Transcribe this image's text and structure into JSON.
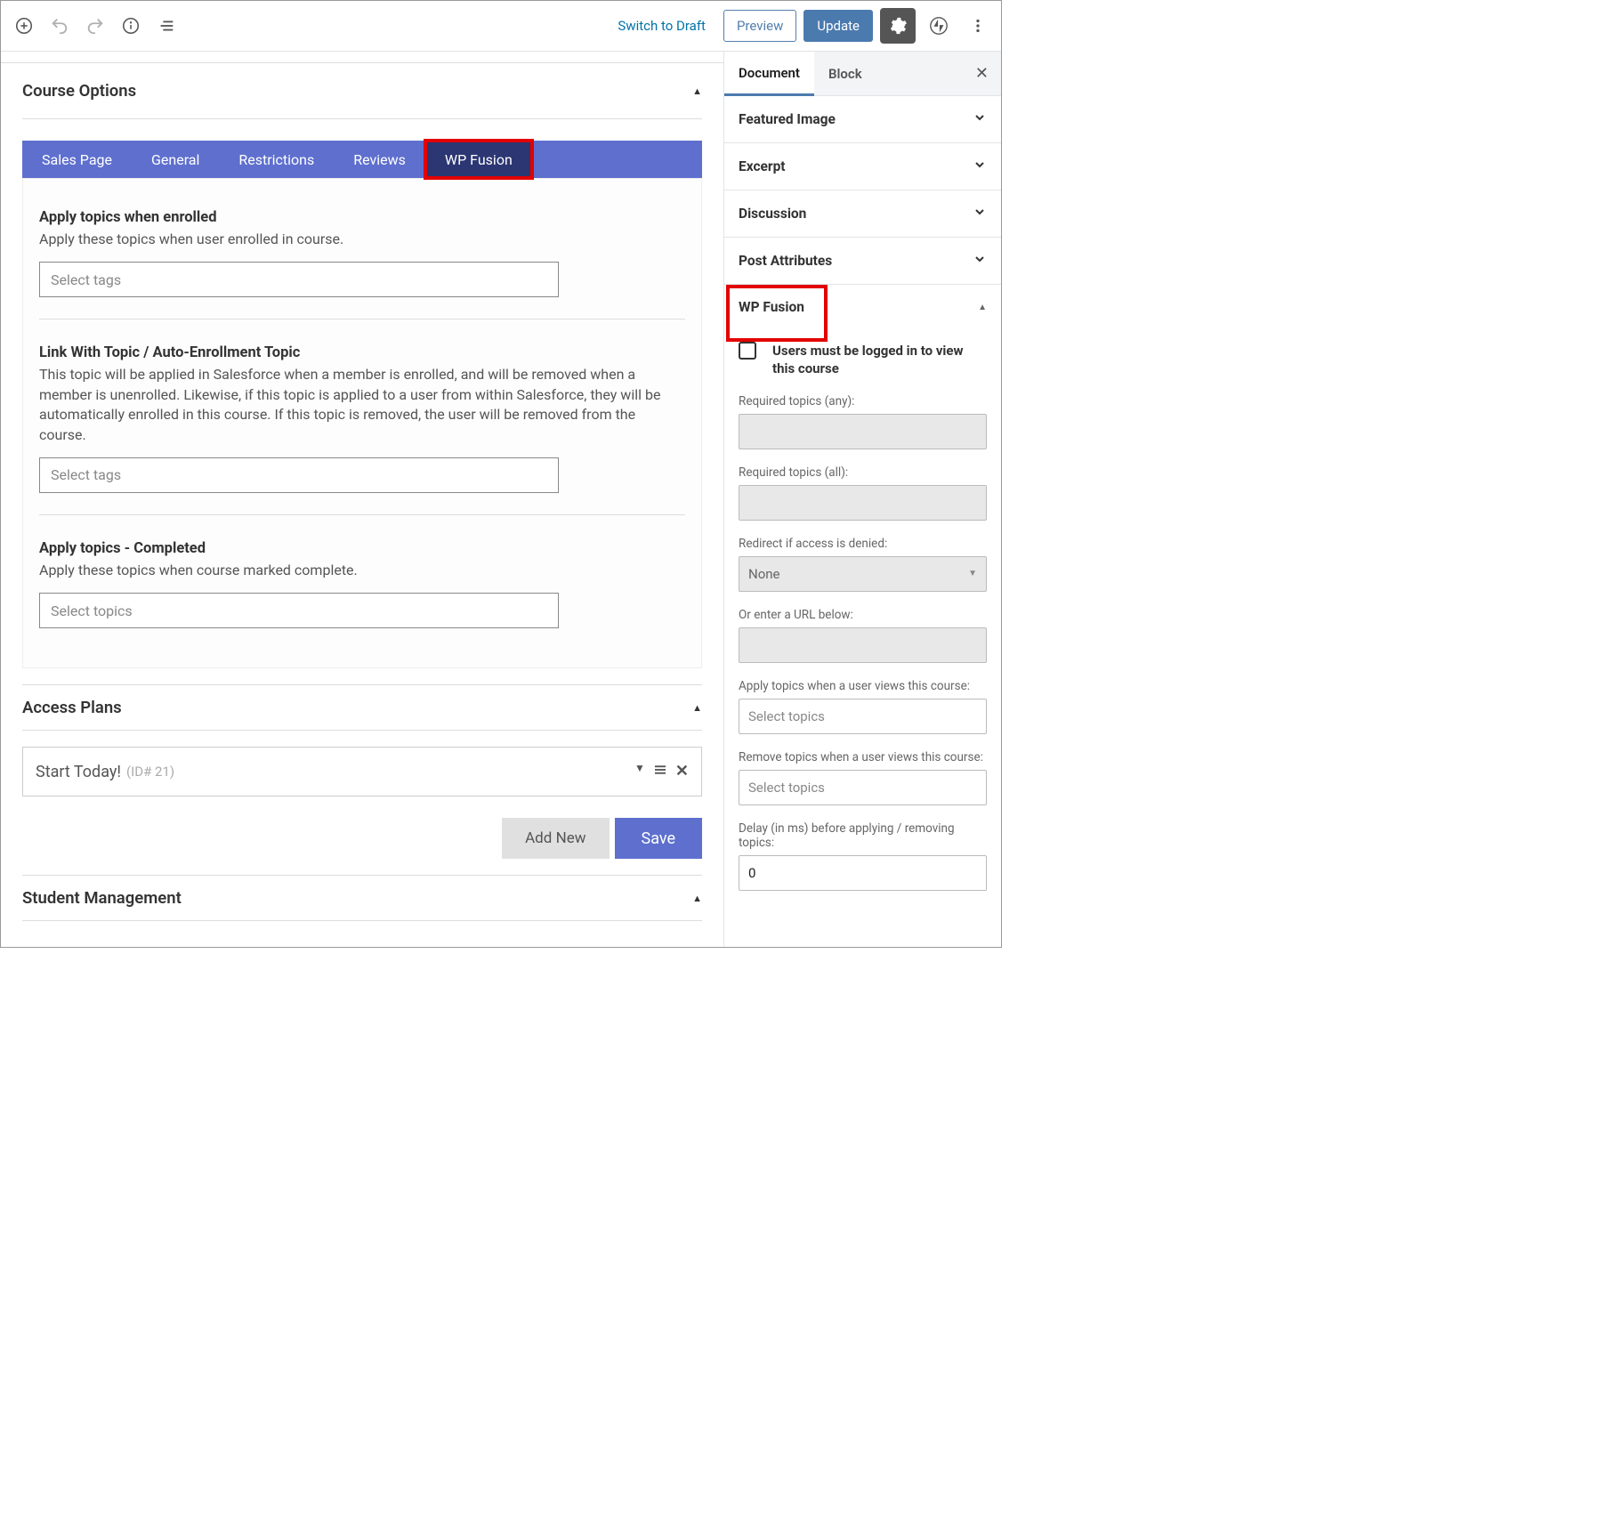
{
  "toolbar": {
    "switch_draft": "Switch to Draft",
    "preview": "Preview",
    "update": "Update"
  },
  "course_options": {
    "title": "Course Options",
    "tabs": [
      {
        "label": "Sales Page",
        "active": false
      },
      {
        "label": "General",
        "active": false
      },
      {
        "label": "Restrictions",
        "active": false
      },
      {
        "label": "Reviews",
        "active": false
      },
      {
        "label": "WP Fusion",
        "active": true
      }
    ],
    "groups": {
      "enrolled": {
        "title": "Apply topics when enrolled",
        "desc": "Apply these topics when user enrolled in course.",
        "placeholder": "Select tags"
      },
      "link": {
        "title": "Link With Topic / Auto-Enrollment Topic",
        "desc": "This topic will be applied in Salesforce when a member is enrolled, and will be removed when a member is unenrolled. Likewise, if this topic is applied to a user from within Salesforce, they will be automatically enrolled in this course. If this topic is removed, the user will be removed from the course.",
        "placeholder": "Select tags"
      },
      "completed": {
        "title": "Apply topics - Completed",
        "desc": "Apply these topics when course marked complete.",
        "placeholder": "Select topics"
      }
    }
  },
  "access_plans": {
    "title": "Access Plans",
    "plan_name": "Start Today!",
    "plan_id": "(ID# 21)",
    "add_new": "Add New",
    "save": "Save"
  },
  "student_mgmt": {
    "title": "Student Management"
  },
  "sidebar": {
    "tabs": {
      "document": "Document",
      "block": "Block"
    },
    "panels": {
      "featured": "Featured Image",
      "excerpt": "Excerpt",
      "discussion": "Discussion",
      "attributes": "Post Attributes",
      "wpfusion": "WP Fusion"
    },
    "wpf": {
      "cb_label": "Users must be logged in to view this course",
      "req_any": "Required topics (any):",
      "req_all": "Required topics (all):",
      "redirect_label": "Redirect if access is denied:",
      "redirect_value": "None",
      "url_label": "Or enter a URL below:",
      "apply_view": "Apply topics when a user views this course:",
      "remove_view": "Remove topics when a user views this course:",
      "select_topics": "Select topics",
      "delay": "Delay (in ms) before applying / removing topics:",
      "delay_value": "0"
    }
  }
}
